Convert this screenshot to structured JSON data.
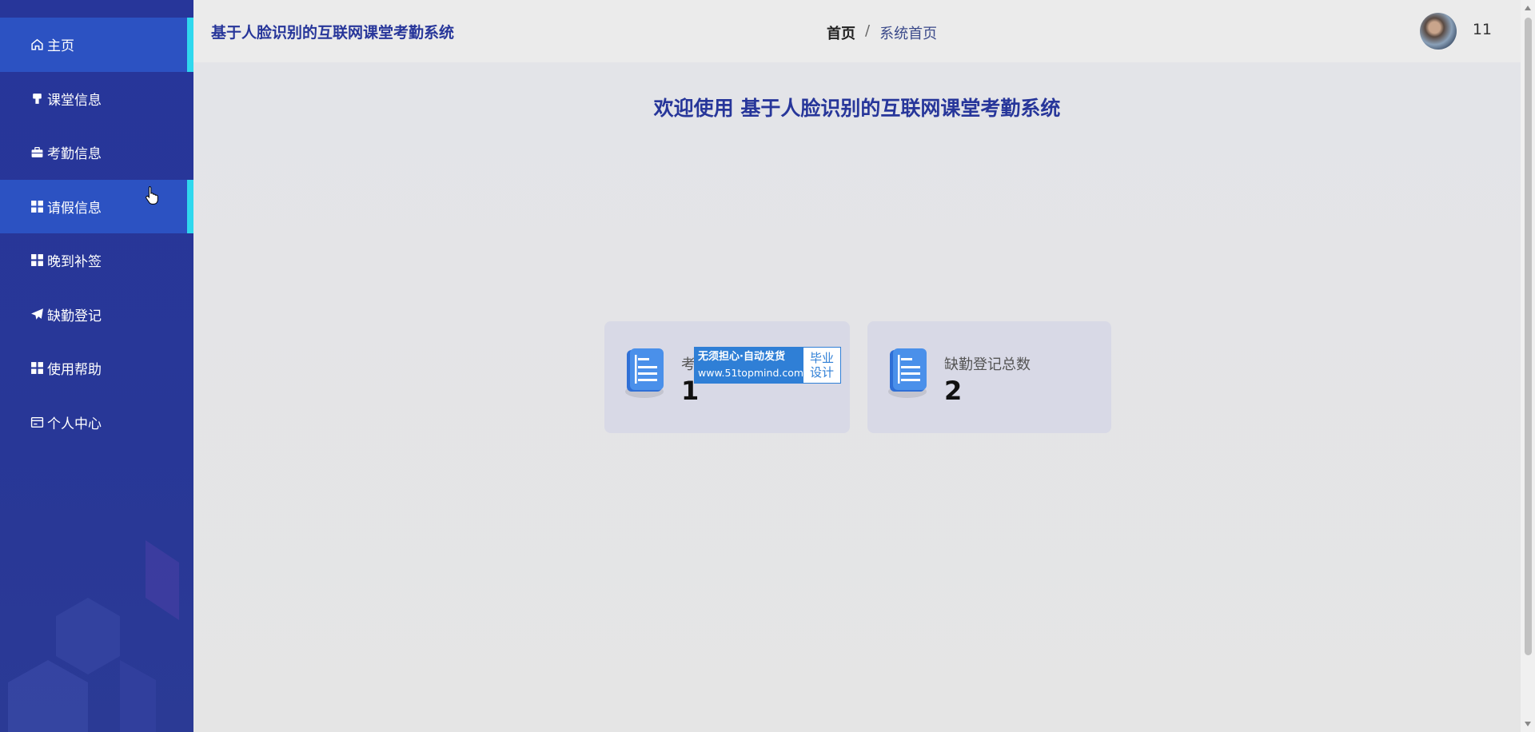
{
  "app": {
    "title": "基于人脸识别的互联网课堂考勤系统"
  },
  "sidebar": {
    "items": [
      {
        "label": "主页",
        "icon": "home-icon",
        "active": true
      },
      {
        "label": "课堂信息",
        "icon": "bookmark-icon",
        "active": false
      },
      {
        "label": "考勤信息",
        "icon": "briefcase-icon",
        "active": false
      },
      {
        "label": "请假信息",
        "icon": "grid-icon",
        "active": true
      },
      {
        "label": "晚到补签",
        "icon": "grid-icon",
        "active": false
      },
      {
        "label": "缺勤登记",
        "icon": "send-icon",
        "active": false
      },
      {
        "label": "使用帮助",
        "icon": "grid-icon",
        "active": false
      },
      {
        "label": "个人中心",
        "icon": "id-card-icon",
        "active": false
      }
    ]
  },
  "header": {
    "breadcrumb_home": "首页",
    "breadcrumb_sep": "/",
    "breadcrumb_current": "系统首页",
    "username": "11"
  },
  "main": {
    "welcome": "欢迎使用 基于人脸识别的互联网课堂考勤系统",
    "cards": [
      {
        "label": "考",
        "value": "1",
        "icon": "document-icon"
      },
      {
        "label": "缺勤登记总数",
        "value": "2",
        "icon": "document-icon"
      }
    ],
    "watermark": {
      "line1": "无须担心·自动发货",
      "line2": "www.51topmind.com",
      "right1": "毕业",
      "right2": "设计"
    }
  },
  "colors": {
    "sidebar_bg": "#27369a",
    "sidebar_active": "#2c52c2",
    "active_indicator": "#2fd8ee",
    "title_color": "#27369a",
    "card_bg": "#d8d9e6"
  }
}
